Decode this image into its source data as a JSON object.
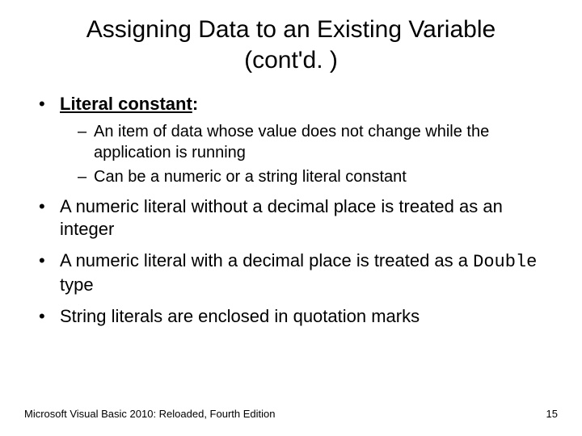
{
  "title_line1": "Assigning Data to an Existing Variable",
  "title_line2": "(cont'd. )",
  "bullets": {
    "b1_label": "Literal constant",
    "b1_colon": ":",
    "b1_sub1": "An item of data whose value does not change while the application is running",
    "b1_sub2": "Can be a numeric or a string literal constant",
    "b2": "A numeric literal without a decimal place is treated as an integer",
    "b3_pre": "A numeric literal with a decimal place is treated as a ",
    "b3_code": "Double",
    "b3_post": " type",
    "b4": "String literals are enclosed in quotation marks"
  },
  "footer_text": "Microsoft Visual Basic 2010: Reloaded, Fourth Edition",
  "page_number": "15"
}
